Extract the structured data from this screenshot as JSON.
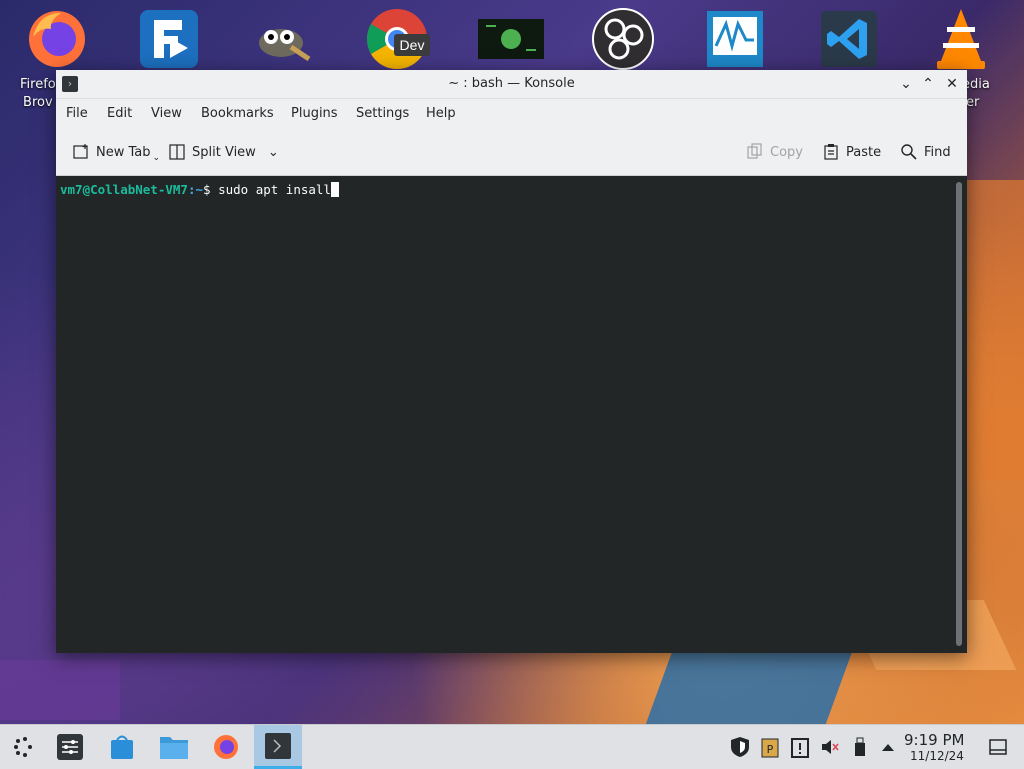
{
  "desktop": {
    "left_label_line1": "Firefo",
    "left_label_line2": "Brov",
    "right_label_line1": "edia",
    "right_label_line2": "er",
    "icons": [
      "firefox-icon",
      "freefilesync-icon",
      "gimp-icon",
      "chrome-dev-icon",
      "mint-terminal-icon",
      "obs-icon",
      "wireshark-monitor-icon",
      "vscode-icon",
      "vlc-icon"
    ],
    "chrome_badge": "Dev"
  },
  "window": {
    "title": "~ : bash — Konsole",
    "menu": [
      "File",
      "Edit",
      "View",
      "Bookmarks",
      "Plugins",
      "Settings",
      "Help"
    ],
    "toolbar": {
      "new_tab": "New Tab",
      "split_view": "Split View",
      "copy": "Copy",
      "paste": "Paste",
      "find": "Find"
    },
    "terminal": {
      "user_host": "vm7@CollabNet-VM7",
      "path": ":~",
      "dollar": "$ ",
      "command": "sudo apt insall"
    }
  },
  "taskbar": {
    "clock_time": "9:19 PM",
    "clock_date": "11/12/24"
  },
  "colors": {
    "terminal_bg": "#232627",
    "prompt_user": "#1abc9c",
    "prompt_path": "#3daee9",
    "taskbar_active": "#a8c8e4"
  }
}
